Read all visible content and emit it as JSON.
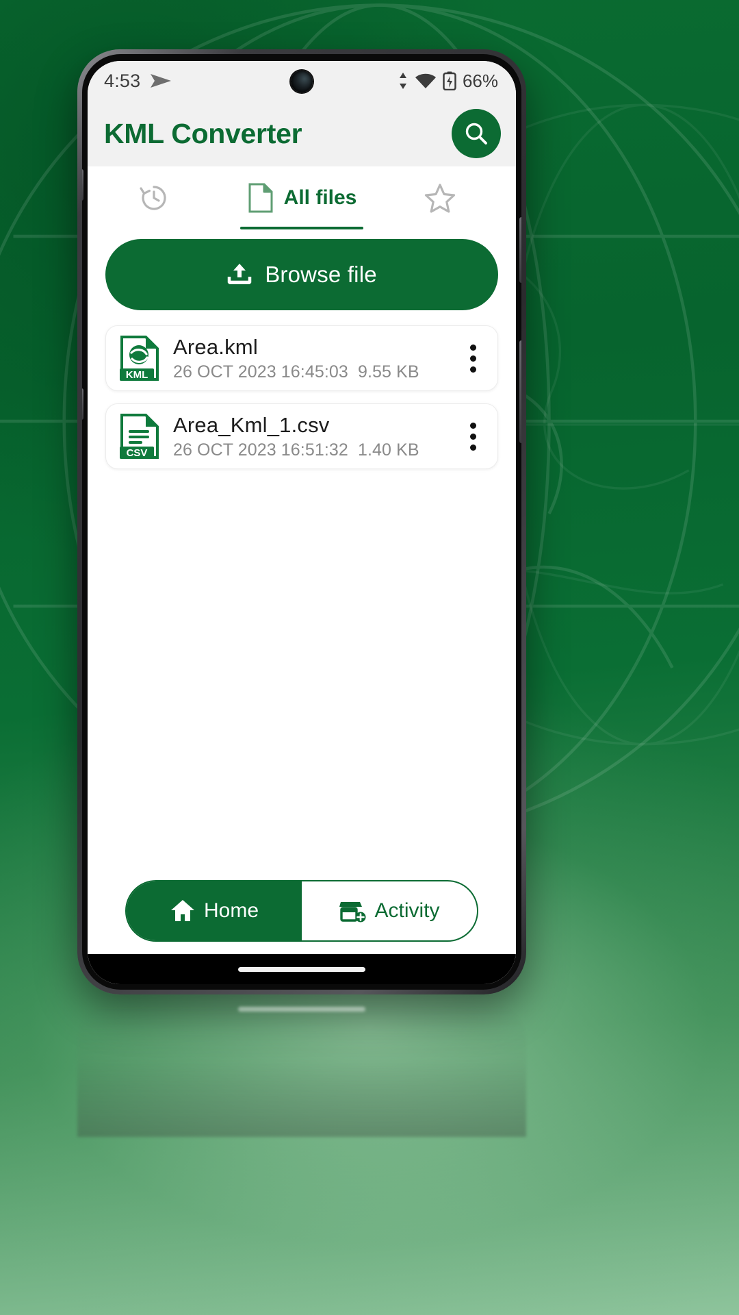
{
  "statusbar": {
    "time": "4:53",
    "left_icon": "send-icon",
    "battery_text": "66%",
    "icons": [
      "data-transfer-icon",
      "wifi-icon",
      "battery-charging-icon"
    ]
  },
  "appbar": {
    "title": "KML Converter",
    "search_icon": "search-icon"
  },
  "tabs": [
    {
      "label": "",
      "icon": "history-icon",
      "active": false,
      "name": "tab-history"
    },
    {
      "label": "All files",
      "icon": "file-icon",
      "active": true,
      "name": "tab-all-files"
    },
    {
      "label": "",
      "icon": "star-icon",
      "active": false,
      "name": "tab-favourites"
    }
  ],
  "browse": {
    "label": "Browse file",
    "icon": "upload-icon"
  },
  "files": [
    {
      "name": "Area.kml",
      "date": "26 OCT 2023 16:45:03",
      "size": "9.55 KB",
      "type": "KML",
      "icon": "kml-file-icon",
      "menu_icon": "more-vertical-icon"
    },
    {
      "name": "Area_Kml_1.csv",
      "date": "26 OCT 2023 16:51:32",
      "size": "1.40 KB",
      "type": "CSV",
      "icon": "csv-file-icon",
      "menu_icon": "more-vertical-icon"
    }
  ],
  "bottom_nav": [
    {
      "label": "Home",
      "icon": "home-icon",
      "active": true,
      "name": "nav-home"
    },
    {
      "label": "Activity",
      "icon": "activity-store-icon",
      "active": false,
      "name": "nav-activity"
    }
  ],
  "colors": {
    "brand_green": "#0c6b33",
    "tab_inactive": "#b6b6b6",
    "file_sub": "#8a8a8a",
    "status_text": "#3c3c3c"
  }
}
